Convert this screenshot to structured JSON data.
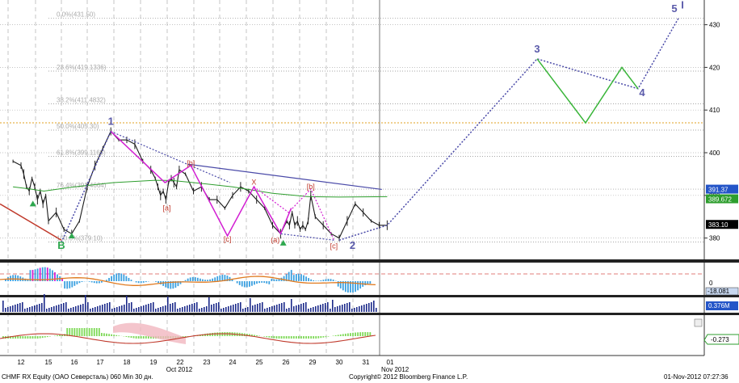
{
  "footer": {
    "left": "CHMF RX Equity (ОАО Северсталь) 060 Min 30 дн.",
    "center": "Copyright© 2012 Bloomberg Finance L.P.",
    "right": "01-Nov-2012 07:27:36"
  },
  "colors": {
    "price": "#1a1a1a",
    "ma_green": "#2e9e2e",
    "trend_blue": "#4a4aa8",
    "projection_green": "#39b539",
    "wave_magenta": "#d21fd2",
    "fib_orange": "#e0a020",
    "label_blue": "#5a5aaa",
    "label_red": "#c0392b",
    "label_green": "#2fa84f"
  },
  "chart_data": [
    {
      "type": "line",
      "panel": "price",
      "y_axis": {
        "ylim": [
          375,
          435
        ],
        "ticks": [
          380,
          390,
          400,
          410,
          420,
          430
        ]
      },
      "x_axis": {
        "day_ticks": [
          "12",
          "15",
          "16",
          "17",
          "18",
          "19",
          "22",
          "23",
          "24",
          "25",
          "26",
          "29",
          "30",
          "31",
          "01"
        ],
        "month_labels": [
          "Oct 2012",
          "Nov 2012"
        ]
      },
      "price_tags": [
        {
          "label": "391.37",
          "value": 391.37,
          "style": "blue"
        },
        {
          "label": "389.672",
          "value": 389.672,
          "style": "green"
        },
        {
          "label": "383.10",
          "value": 383.1,
          "style": "black"
        }
      ],
      "fib_levels": [
        {
          "label": "0.0%(431.50)",
          "value": 431.5
        },
        {
          "label": "23.6%(419.1336)",
          "value": 419.13
        },
        {
          "label": "38.2%(411.4832)",
          "value": 411.48
        },
        {
          "label": "50.0%(405.30)",
          "value": 405.3
        },
        {
          "label": "61.8%(399.1168)",
          "value": 399.12
        },
        {
          "label": "76.4%(391.4664)",
          "value": 391.47
        },
        {
          "label": "100.0%(379.10)",
          "value": 379.1
        }
      ],
      "orange_level": 407.0,
      "wave_labels": [
        {
          "text": "1",
          "day": 17.4,
          "value": 406.5,
          "color": "blue"
        },
        {
          "text": "2",
          "day": 30.5,
          "value": 377.5,
          "color": "blue"
        },
        {
          "text": "3",
          "day": 32.1,
          "value": 423.5,
          "color": "blue"
        },
        {
          "text": "4",
          "day": 33.5,
          "value": 413.3,
          "color": "blue"
        },
        {
          "text": "5",
          "day": 33.9,
          "value": 433.0,
          "color": "blue"
        },
        {
          "text": "I",
          "day": 34.0,
          "value": 433.8,
          "color": "blue"
        },
        {
          "text": "B",
          "day": 15.5,
          "value": 377.5,
          "color": "green"
        },
        {
          "text": "X",
          "day": 24.8,
          "value": 392.5,
          "color": "red"
        },
        {
          "text": "[a]",
          "day": 20.5,
          "value": 386.5,
          "color": "red"
        },
        {
          "text": "[b]",
          "day": 22.4,
          "value": 397.0,
          "color": "red"
        },
        {
          "text": "[c]",
          "day": 23.8,
          "value": 379.2,
          "color": "red"
        },
        {
          "text": "(a)",
          "day": 25.6,
          "value": 379.0,
          "color": "red"
        },
        {
          "text": "[b]",
          "day": 28.8,
          "value": 391.5,
          "color": "red"
        },
        {
          "text": "[c]",
          "day": 29.8,
          "value": 377.6,
          "color": "red"
        }
      ]
    },
    {
      "type": "bar",
      "panel": "macd",
      "name": "",
      "tags": [
        {
          "label": "-18.081",
          "value": -18.081
        }
      ],
      "zero_label": "0"
    },
    {
      "type": "bar",
      "panel": "volume",
      "tags": [
        {
          "label": "0.376M",
          "value": 0.376
        }
      ]
    },
    {
      "type": "area",
      "panel": "oscillator",
      "tags": [
        {
          "label": "-0.273",
          "value": -0.273
        }
      ]
    }
  ]
}
